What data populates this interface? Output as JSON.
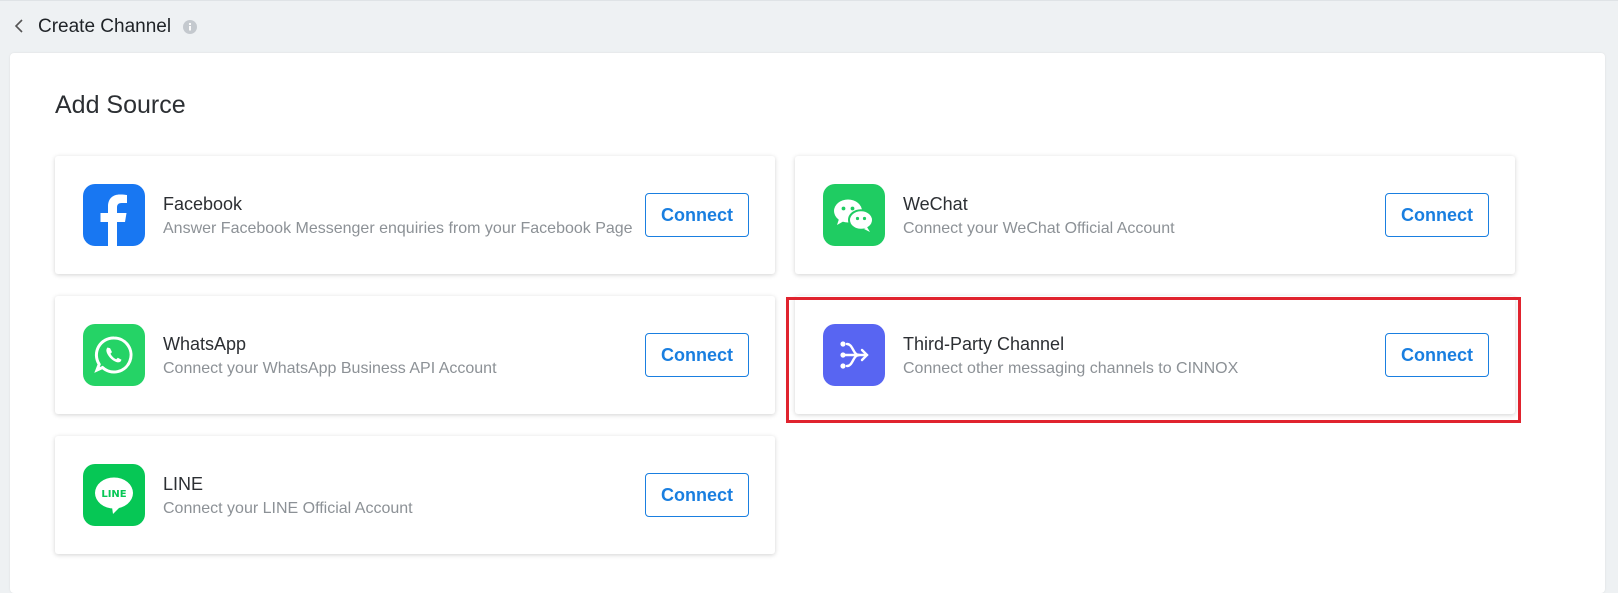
{
  "header": {
    "title": "Create Channel"
  },
  "section": {
    "title": "Add Source"
  },
  "channels": [
    {
      "name": "Facebook",
      "description": "Answer Facebook Messenger enquiries from your Facebook Page",
      "button": "Connect",
      "icon": "facebook-icon",
      "color": "#1877f2"
    },
    {
      "name": "WeChat",
      "description": "Connect your WeChat Official Account",
      "button": "Connect",
      "icon": "wechat-icon",
      "color": "#1fcc62"
    },
    {
      "name": "WhatsApp",
      "description": "Connect your WhatsApp Business API Account",
      "button": "Connect",
      "icon": "whatsapp-icon",
      "color": "#25d366"
    },
    {
      "name": "Third-Party Channel",
      "description": "Connect other messaging channels to CINNOX",
      "button": "Connect",
      "icon": "third-party-channel-icon",
      "color": "#5865f2"
    },
    {
      "name": "LINE",
      "description": "Connect your LINE Official Account",
      "button": "Connect",
      "icon": "line-icon",
      "color": "#06c755"
    }
  ],
  "colors": {
    "accent": "#1a7fe0",
    "highlight": "#e0232e"
  }
}
